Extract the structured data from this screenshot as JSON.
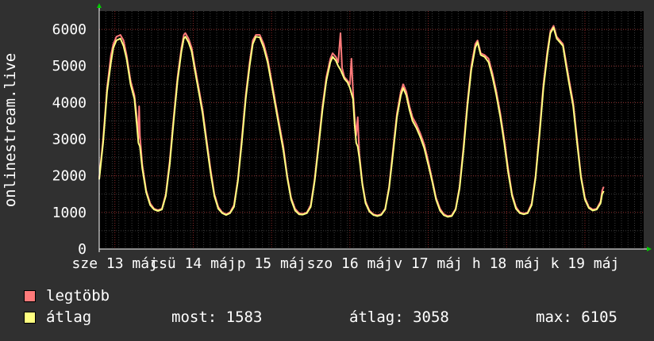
{
  "chart_data": {
    "type": "line",
    "ylabel": "onlinestream.live",
    "ylim": [
      0,
      6500
    ],
    "yticks": [
      0,
      1000,
      2000,
      3000,
      4000,
      5000,
      6000
    ],
    "xlim": [
      0,
      6.95
    ],
    "xticks": [
      {
        "x": 0.2,
        "label": "sze 13 máj"
      },
      {
        "x": 1.2,
        "label": "csü 14 máj"
      },
      {
        "x": 2.2,
        "label": "p 15 máj"
      },
      {
        "x": 3.2,
        "label": "szo 16 máj"
      },
      {
        "x": 4.2,
        "label": "v 17 máj"
      },
      {
        "x": 5.2,
        "label": "h 18 máj"
      },
      {
        "x": 6.2,
        "label": "k 19 máj"
      }
    ],
    "grid": true,
    "series": [
      {
        "name": "legtöbb",
        "color": "#ff7a7a",
        "points": [
          [
            0.0,
            1950
          ],
          [
            0.05,
            3000
          ],
          [
            0.1,
            4400
          ],
          [
            0.15,
            5300
          ],
          [
            0.18,
            5600
          ],
          [
            0.22,
            5800
          ],
          [
            0.27,
            5850
          ],
          [
            0.31,
            5700
          ],
          [
            0.35,
            5300
          ],
          [
            0.4,
            4600
          ],
          [
            0.45,
            4200
          ],
          [
            0.48,
            3600
          ],
          [
            0.5,
            3000
          ],
          [
            0.51,
            3900
          ],
          [
            0.52,
            3100
          ],
          [
            0.55,
            2300
          ],
          [
            0.6,
            1600
          ],
          [
            0.65,
            1250
          ],
          [
            0.7,
            1100
          ],
          [
            0.75,
            1060
          ],
          [
            0.8,
            1100
          ],
          [
            0.85,
            1500
          ],
          [
            0.9,
            2400
          ],
          [
            0.95,
            3600
          ],
          [
            1.0,
            4700
          ],
          [
            1.05,
            5500
          ],
          [
            1.08,
            5850
          ],
          [
            1.1,
            5900
          ],
          [
            1.14,
            5750
          ],
          [
            1.18,
            5500
          ],
          [
            1.22,
            5000
          ],
          [
            1.27,
            4400
          ],
          [
            1.32,
            3800
          ],
          [
            1.37,
            3000
          ],
          [
            1.42,
            2200
          ],
          [
            1.47,
            1500
          ],
          [
            1.52,
            1150
          ],
          [
            1.57,
            1000
          ],
          [
            1.62,
            950
          ],
          [
            1.67,
            1000
          ],
          [
            1.72,
            1200
          ],
          [
            1.77,
            1900
          ],
          [
            1.82,
            3000
          ],
          [
            1.87,
            4200
          ],
          [
            1.92,
            5100
          ],
          [
            1.96,
            5700
          ],
          [
            2.0,
            5850
          ],
          [
            2.05,
            5850
          ],
          [
            2.1,
            5600
          ],
          [
            2.15,
            5200
          ],
          [
            2.2,
            4600
          ],
          [
            2.25,
            4000
          ],
          [
            2.3,
            3400
          ],
          [
            2.35,
            2800
          ],
          [
            2.4,
            2000
          ],
          [
            2.45,
            1400
          ],
          [
            2.5,
            1100
          ],
          [
            2.55,
            980
          ],
          [
            2.6,
            960
          ],
          [
            2.65,
            1000
          ],
          [
            2.7,
            1200
          ],
          [
            2.75,
            1900
          ],
          [
            2.8,
            2900
          ],
          [
            2.85,
            3900
          ],
          [
            2.9,
            4700
          ],
          [
            2.95,
            5200
          ],
          [
            2.98,
            5350
          ],
          [
            3.02,
            5250
          ],
          [
            3.05,
            5100
          ],
          [
            3.08,
            5900
          ],
          [
            3.1,
            4950
          ],
          [
            3.13,
            4700
          ],
          [
            3.17,
            4600
          ],
          [
            3.2,
            4500
          ],
          [
            3.22,
            5200
          ],
          [
            3.24,
            4300
          ],
          [
            3.26,
            3600
          ],
          [
            3.28,
            3100
          ],
          [
            3.3,
            3600
          ],
          [
            3.32,
            2600
          ],
          [
            3.36,
            1800
          ],
          [
            3.4,
            1300
          ],
          [
            3.45,
            1050
          ],
          [
            3.5,
            950
          ],
          [
            3.55,
            920
          ],
          [
            3.6,
            950
          ],
          [
            3.65,
            1100
          ],
          [
            3.7,
            1700
          ],
          [
            3.75,
            2700
          ],
          [
            3.8,
            3700
          ],
          [
            3.85,
            4300
          ],
          [
            3.88,
            4500
          ],
          [
            3.92,
            4300
          ],
          [
            3.96,
            3900
          ],
          [
            4.0,
            3600
          ],
          [
            4.05,
            3400
          ],
          [
            4.1,
            3150
          ],
          [
            4.15,
            2850
          ],
          [
            4.2,
            2400
          ],
          [
            4.25,
            1900
          ],
          [
            4.3,
            1400
          ],
          [
            4.35,
            1100
          ],
          [
            4.4,
            950
          ],
          [
            4.45,
            900
          ],
          [
            4.5,
            920
          ],
          [
            4.55,
            1100
          ],
          [
            4.6,
            1700
          ],
          [
            4.65,
            2800
          ],
          [
            4.7,
            4000
          ],
          [
            4.75,
            5000
          ],
          [
            4.8,
            5600
          ],
          [
            4.83,
            5700
          ],
          [
            4.87,
            5350
          ],
          [
            4.92,
            5300
          ],
          [
            4.97,
            5200
          ],
          [
            5.02,
            4800
          ],
          [
            5.07,
            4300
          ],
          [
            5.12,
            3700
          ],
          [
            5.17,
            3000
          ],
          [
            5.22,
            2200
          ],
          [
            5.27,
            1500
          ],
          [
            5.32,
            1150
          ],
          [
            5.37,
            1000
          ],
          [
            5.42,
            970
          ],
          [
            5.47,
            1000
          ],
          [
            5.52,
            1250
          ],
          [
            5.57,
            2000
          ],
          [
            5.62,
            3200
          ],
          [
            5.67,
            4500
          ],
          [
            5.72,
            5400
          ],
          [
            5.76,
            5950
          ],
          [
            5.8,
            6100
          ],
          [
            5.84,
            5800
          ],
          [
            5.88,
            5700
          ],
          [
            5.92,
            5600
          ],
          [
            5.96,
            5100
          ],
          [
            6.0,
            4600
          ],
          [
            6.05,
            4000
          ],
          [
            6.1,
            3000
          ],
          [
            6.15,
            2000
          ],
          [
            6.2,
            1400
          ],
          [
            6.25,
            1150
          ],
          [
            6.3,
            1080
          ],
          [
            6.35,
            1100
          ],
          [
            6.4,
            1300
          ],
          [
            6.42,
            1600
          ],
          [
            6.44,
            1700
          ]
        ]
      },
      {
        "name": "átlag",
        "color": "#ffff80",
        "points": [
          [
            0.0,
            1900
          ],
          [
            0.05,
            2900
          ],
          [
            0.1,
            4300
          ],
          [
            0.15,
            5100
          ],
          [
            0.18,
            5500
          ],
          [
            0.22,
            5700
          ],
          [
            0.27,
            5750
          ],
          [
            0.31,
            5550
          ],
          [
            0.35,
            5200
          ],
          [
            0.4,
            4500
          ],
          [
            0.45,
            4100
          ],
          [
            0.48,
            3400
          ],
          [
            0.5,
            2900
          ],
          [
            0.52,
            2800
          ],
          [
            0.55,
            2200
          ],
          [
            0.6,
            1550
          ],
          [
            0.65,
            1200
          ],
          [
            0.7,
            1080
          ],
          [
            0.75,
            1040
          ],
          [
            0.8,
            1080
          ],
          [
            0.85,
            1450
          ],
          [
            0.9,
            2300
          ],
          [
            0.95,
            3500
          ],
          [
            1.0,
            4600
          ],
          [
            1.05,
            5400
          ],
          [
            1.08,
            5750
          ],
          [
            1.1,
            5800
          ],
          [
            1.14,
            5650
          ],
          [
            1.18,
            5400
          ],
          [
            1.22,
            4900
          ],
          [
            1.27,
            4300
          ],
          [
            1.32,
            3700
          ],
          [
            1.37,
            2900
          ],
          [
            1.42,
            2100
          ],
          [
            1.47,
            1450
          ],
          [
            1.52,
            1100
          ],
          [
            1.57,
            980
          ],
          [
            1.62,
            930
          ],
          [
            1.67,
            980
          ],
          [
            1.72,
            1150
          ],
          [
            1.77,
            1850
          ],
          [
            1.82,
            2900
          ],
          [
            1.87,
            4100
          ],
          [
            1.92,
            5000
          ],
          [
            1.96,
            5600
          ],
          [
            2.0,
            5800
          ],
          [
            2.05,
            5780
          ],
          [
            2.1,
            5500
          ],
          [
            2.15,
            5100
          ],
          [
            2.2,
            4500
          ],
          [
            2.25,
            3900
          ],
          [
            2.3,
            3300
          ],
          [
            2.35,
            2700
          ],
          [
            2.4,
            1950
          ],
          [
            2.45,
            1350
          ],
          [
            2.5,
            1050
          ],
          [
            2.55,
            950
          ],
          [
            2.6,
            940
          ],
          [
            2.65,
            980
          ],
          [
            2.7,
            1150
          ],
          [
            2.75,
            1850
          ],
          [
            2.8,
            2800
          ],
          [
            2.85,
            3800
          ],
          [
            2.9,
            4600
          ],
          [
            2.95,
            5100
          ],
          [
            2.98,
            5250
          ],
          [
            3.02,
            5150
          ],
          [
            3.05,
            5000
          ],
          [
            3.08,
            4900
          ],
          [
            3.1,
            4800
          ],
          [
            3.13,
            4650
          ],
          [
            3.17,
            4550
          ],
          [
            3.2,
            4400
          ],
          [
            3.24,
            4100
          ],
          [
            3.26,
            3400
          ],
          [
            3.28,
            2900
          ],
          [
            3.3,
            2800
          ],
          [
            3.32,
            2500
          ],
          [
            3.36,
            1750
          ],
          [
            3.4,
            1250
          ],
          [
            3.45,
            1020
          ],
          [
            3.5,
            930
          ],
          [
            3.55,
            900
          ],
          [
            3.6,
            930
          ],
          [
            3.65,
            1080
          ],
          [
            3.7,
            1650
          ],
          [
            3.75,
            2600
          ],
          [
            3.8,
            3600
          ],
          [
            3.85,
            4200
          ],
          [
            3.88,
            4400
          ],
          [
            3.92,
            4200
          ],
          [
            3.96,
            3800
          ],
          [
            4.0,
            3500
          ],
          [
            4.05,
            3300
          ],
          [
            4.1,
            3050
          ],
          [
            4.15,
            2750
          ],
          [
            4.2,
            2300
          ],
          [
            4.25,
            1850
          ],
          [
            4.3,
            1350
          ],
          [
            4.35,
            1050
          ],
          [
            4.4,
            920
          ],
          [
            4.45,
            880
          ],
          [
            4.5,
            900
          ],
          [
            4.55,
            1080
          ],
          [
            4.6,
            1650
          ],
          [
            4.65,
            2700
          ],
          [
            4.7,
            3900
          ],
          [
            4.75,
            4900
          ],
          [
            4.8,
            5500
          ],
          [
            4.83,
            5650
          ],
          [
            4.87,
            5300
          ],
          [
            4.92,
            5250
          ],
          [
            4.97,
            5100
          ],
          [
            5.02,
            4700
          ],
          [
            5.07,
            4200
          ],
          [
            5.12,
            3600
          ],
          [
            5.17,
            2900
          ],
          [
            5.22,
            2100
          ],
          [
            5.27,
            1450
          ],
          [
            5.32,
            1100
          ],
          [
            5.37,
            980
          ],
          [
            5.42,
            950
          ],
          [
            5.47,
            980
          ],
          [
            5.52,
            1200
          ],
          [
            5.57,
            1950
          ],
          [
            5.62,
            3100
          ],
          [
            5.67,
            4400
          ],
          [
            5.72,
            5300
          ],
          [
            5.76,
            5900
          ],
          [
            5.8,
            6050
          ],
          [
            5.84,
            5750
          ],
          [
            5.88,
            5650
          ],
          [
            5.92,
            5550
          ],
          [
            5.96,
            5000
          ],
          [
            6.0,
            4500
          ],
          [
            6.05,
            3900
          ],
          [
            6.1,
            2900
          ],
          [
            6.15,
            1950
          ],
          [
            6.2,
            1350
          ],
          [
            6.25,
            1120
          ],
          [
            6.3,
            1050
          ],
          [
            6.35,
            1080
          ],
          [
            6.4,
            1250
          ],
          [
            6.42,
            1500
          ],
          [
            6.44,
            1583
          ]
        ]
      }
    ]
  },
  "legend": {
    "max_label": "legtöbb",
    "avg_label": "átlag",
    "now_text": "most: 1583",
    "avg_text": "átlag: 3058",
    "peak_text": "max: 6105"
  }
}
